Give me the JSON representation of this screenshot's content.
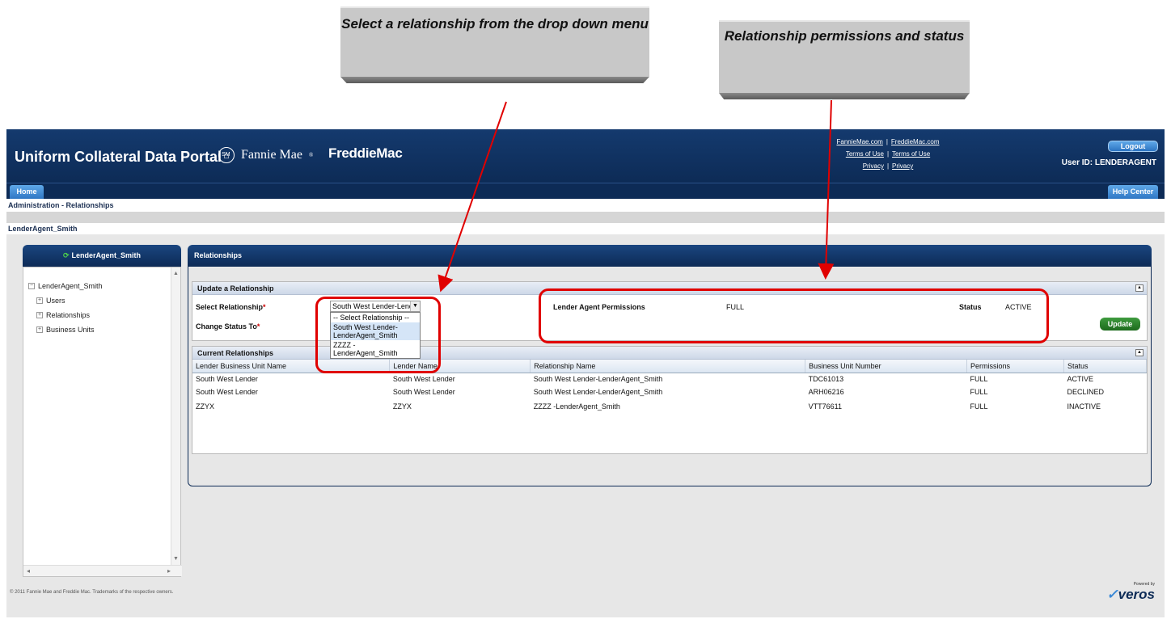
{
  "callouts": {
    "left": "Select a relationship from the drop down menu",
    "right": "Relationship permissions and status"
  },
  "header": {
    "title": "Uniform Collateral Data Portal",
    "title_mark": "SM",
    "fannie_mae": "Fannie Mae",
    "fannie_mark": "®",
    "freddie_mac": "FreddieMac",
    "links": {
      "fannie_site": "FannieMae.com",
      "freddie_site": "FreddieMac.com",
      "terms1": "Terms of Use",
      "terms2": "Terms of Use",
      "privacy1": "Privacy",
      "privacy2": "Privacy",
      "separator": "|"
    },
    "logout": "Logout",
    "user_id": "User ID: LENDERAGENT"
  },
  "nav": {
    "home": "Home",
    "help": "Help Center"
  },
  "breadcrumb": "Administration - Relationships",
  "context_title": "LenderAgent_Smith",
  "sidebar": {
    "header": "LenderAgent_Smith",
    "root": "LenderAgent_Smith",
    "items": [
      {
        "label": "Users"
      },
      {
        "label": "Relationships"
      },
      {
        "label": "Business Units"
      }
    ]
  },
  "main": {
    "title": "Relationships",
    "update_section": {
      "title": "Update a Relationship",
      "select_label": "Select Relationship",
      "select_value": "South West Lender-LenderAgent_Smith",
      "status_label": "Change Status To",
      "required_mark": "*",
      "dropdown_options": [
        "-- Select Relationship --",
        "South West Lender-LenderAgent_Smith",
        "ZZZZ -LenderAgent_Smith"
      ],
      "permissions_label": "Lender Agent Permissions",
      "permissions_value": "FULL",
      "status_field_label": "Status",
      "status_value": "ACTIVE",
      "update_button": "Update"
    },
    "current_section": {
      "title": "Current Relationships",
      "columns": [
        "Lender Business Unit Name",
        "Lender Name",
        "Relationship Name",
        "Business Unit Number",
        "Permissions",
        "Status"
      ],
      "rows": [
        [
          "South West Lender",
          "South West Lender",
          "South West Lender-LenderAgent_Smith",
          "TDC61013",
          "FULL",
          "ACTIVE"
        ],
        [
          "South West Lender",
          "South West Lender",
          "South West Lender-LenderAgent_Smith",
          "ARH06216",
          "FULL",
          "DECLINED"
        ],
        [
          "ZZYX",
          "ZZYX",
          "ZZZZ -LenderAgent_Smith",
          "VTT76611",
          "FULL",
          "INACTIVE"
        ]
      ]
    }
  },
  "footer": {
    "copyright": "© 2011 Fannie Mae and Freddie Mac. Trademarks of the respective owners.",
    "powered_by": "Powered by",
    "veros": "veros"
  },
  "colors": {
    "header_blue": "#0d2b56",
    "accent_blue": "#2c74c2",
    "highlight_red": "#e00000",
    "button_green": "#1d6a1d"
  }
}
